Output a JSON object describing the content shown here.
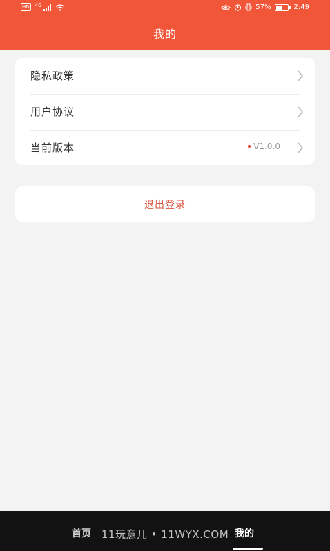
{
  "status_bar": {
    "left_badge": "HD",
    "network": "4G",
    "battery_text": "57%",
    "time": "2:49",
    "battery_level": 0.57
  },
  "header": {
    "title": "我的"
  },
  "menu": {
    "items": [
      {
        "label": "隐私政策",
        "icon": "chevron-right-icon"
      },
      {
        "label": "用户协议",
        "icon": "chevron-right-icon"
      },
      {
        "label": "当前版本",
        "value": "V1.0.0",
        "icon": "chevron-right-icon"
      }
    ]
  },
  "logout": {
    "label": "退出登录"
  },
  "tabbar": {
    "tabs": [
      {
        "label": "首页"
      },
      {
        "label": "我的"
      }
    ],
    "watermark": "11玩意儿 • 11WYX.COM"
  },
  "colors": {
    "brand": "#f15639",
    "logout_text": "#d9533c",
    "tabbar_bg": "#121212"
  }
}
